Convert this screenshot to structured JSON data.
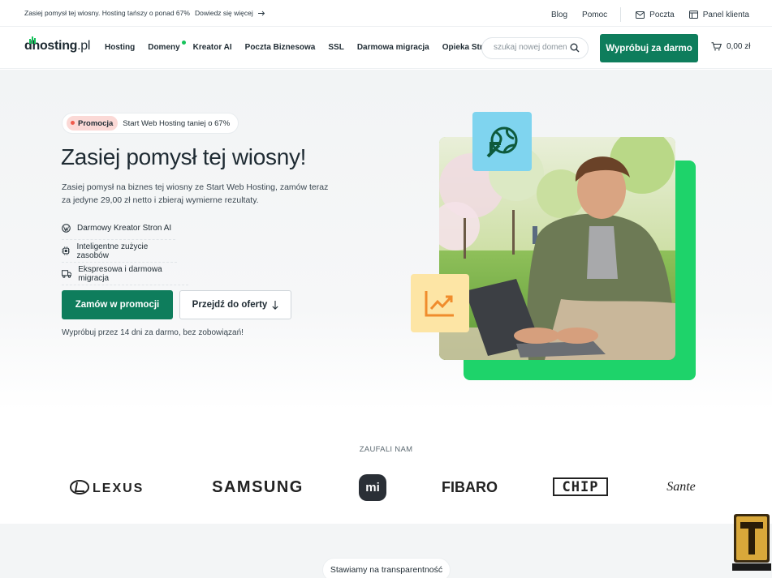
{
  "topbar": {
    "promo_text": "Zasiej pomysł tej wiosny. Hosting tańszy o ponad 67%",
    "promo_link": "Dowiedz się więcej",
    "links": {
      "blog": "Blog",
      "help": "Pomoc",
      "mail": "Poczta",
      "panel": "Panel klienta"
    }
  },
  "header": {
    "logo_main": "dhosting",
    "logo_suffix": ".pl",
    "nav": [
      "Hosting",
      "Domeny",
      "Kreator AI",
      "Poczta Biznesowa",
      "SSL",
      "Darmowa migracja",
      "Opieka Stron"
    ],
    "search_placeholder": "szukaj nowej domeny",
    "cta": "Wypróbuj za darmo",
    "cart_total": "0,00 zł"
  },
  "hero": {
    "badge_tag": "Promocja",
    "badge_text": "Start Web Hosting taniej o 67%",
    "title": "Zasiej pomysł tej wiosny!",
    "description": "Zasiej pomysł na biznes tej wiosny ze Start Web Hosting, zamów teraz za jedyne 29,00 zł netto i zbieraj wymierne rezultaty.",
    "features": [
      "Darmowy Kreator Stron AI",
      "Inteligentne zużycie zasobów",
      "Ekspresowa i darmowa migracja"
    ],
    "order_button": "Zamów w promocji",
    "offer_button": "Przejdź do oferty",
    "trial_note": "Wypróbuj przez 14 dni za darmo, bez zobowiązań!"
  },
  "trusted": {
    "title": "ZAUFALI NAM",
    "brands": [
      "LEXUS",
      "SAMSUNG",
      "mi",
      "FIBARO",
      "CHIP",
      "Sante"
    ]
  },
  "bottom": {
    "pill": "Stawiamy na transparentność"
  },
  "colors": {
    "primary": "#0e7d5c",
    "accent_green": "#1ed36a",
    "promo_red": "#ef5a4c",
    "tile_blue": "#7fd4ef",
    "tile_yellow": "#fde5a5"
  }
}
